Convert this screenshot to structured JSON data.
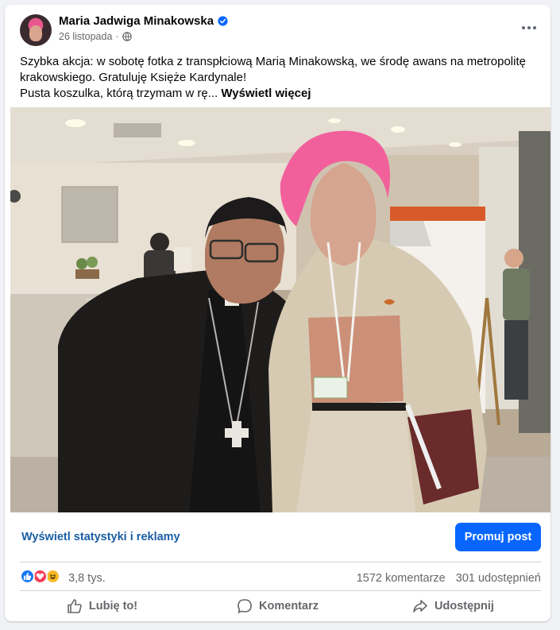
{
  "post": {
    "author": "Maria Jadwiga Minakowska",
    "date": "26 listopada",
    "date_separator": "·",
    "icons": {
      "verified": "verified-badge-icon",
      "audience": "globe-icon",
      "menu": "more-options-icon"
    },
    "text_line1": "Szybka akcja: w sobotę fotka z transpłciową Marią Minakowską, we środę awans na metropolitę krakowskiego. Gratuluję Księże Kardynale!",
    "text_line2": "Pusta koszulka, którą trzymam w rę...",
    "see_more": "Wyświetl więcej"
  },
  "promo": {
    "stats_link": "Wyświetl statystyki i reklamy",
    "promote_button": "Promuj post"
  },
  "reactions": {
    "types": [
      "like",
      "love",
      "haha"
    ],
    "count": "3,8 tys.",
    "comments": "1572 komentarze",
    "shares": "301 udostępnień"
  },
  "actions": {
    "like": "Lubię to!",
    "comment": "Komentarz",
    "share": "Udostępnij"
  },
  "colors": {
    "accent": "#0866ff",
    "link": "#1b5ea4",
    "secondary_text": "#65676b",
    "like": "#1877f2",
    "love": "#f33e58",
    "haha": "#f7b928"
  }
}
